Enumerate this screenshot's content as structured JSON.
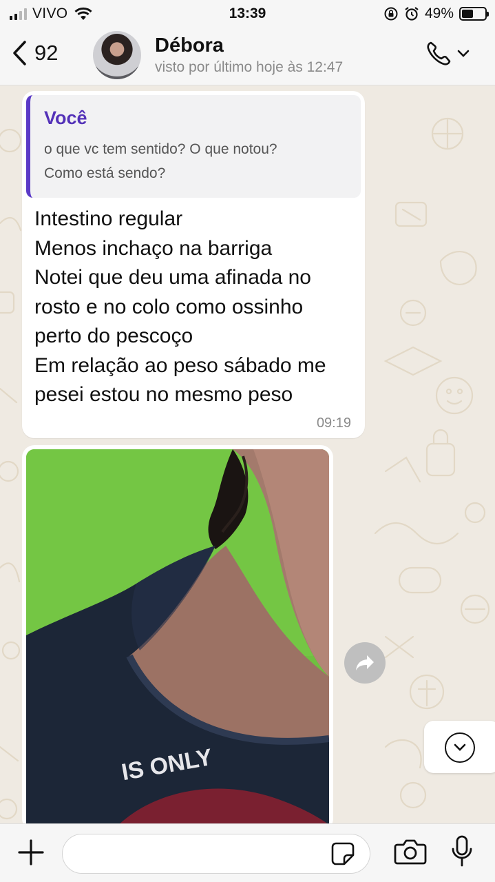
{
  "status_bar": {
    "carrier": "VIVO",
    "time": "13:39",
    "battery": "49%",
    "battery_level": 0.49,
    "signal_bars": 2
  },
  "header": {
    "back_count": "92",
    "contact_name": "Débora",
    "contact_status": "visto por último hoje às 12:47"
  },
  "messages": [
    {
      "quote": {
        "author": "Você",
        "text": "o que vc tem sentido? O que notou?\nComo está sendo?"
      },
      "text": "Intestino regular\nMenos inchaço na barriga\nNotei que deu uma afinada no\nrosto e no colo como ossinho\nperto do pescoço\nEm relação ao peso sábado me\npesei estou no mesmo peso",
      "time": "09:19"
    }
  ],
  "photo": {
    "shirt_text": "IS ONLY"
  },
  "icons": {
    "back": "chevron-left-icon",
    "call": "phone-icon",
    "forward": "forward-icon",
    "scroll": "chevron-down-icon",
    "plus": "plus-icon",
    "sticker": "sticker-icon",
    "camera": "camera-icon",
    "mic": "microphone-icon"
  },
  "colors": {
    "quote_accent": "#5b3ac7",
    "quote_author": "#5432b8",
    "chat_bg": "#efeae2",
    "bubble_bg": "#ffffff"
  }
}
